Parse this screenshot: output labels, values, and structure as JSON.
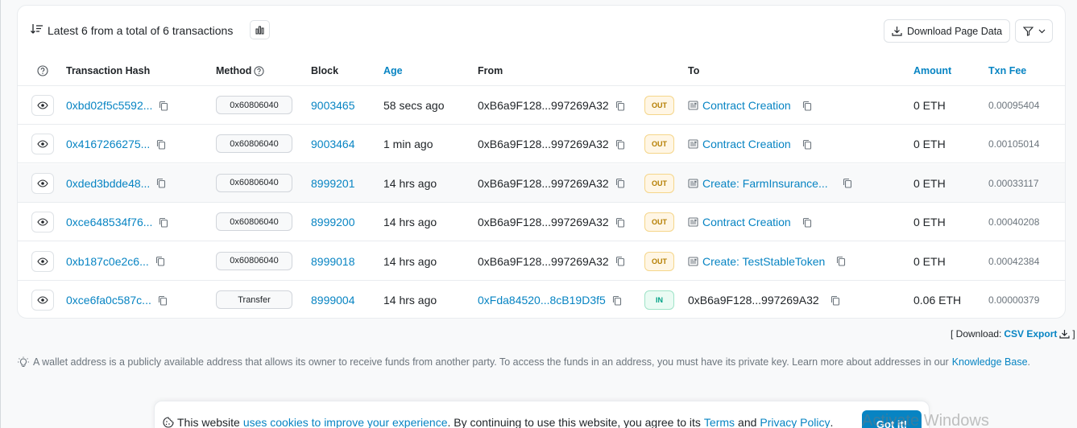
{
  "summary": {
    "text": "Latest 6 from a total of 6 transactions"
  },
  "actions": {
    "download_label": "Download Page Data"
  },
  "columns": {
    "hash": "Transaction Hash",
    "method": "Method",
    "block": "Block",
    "age": "Age",
    "from": "From",
    "to": "To",
    "amount": "Amount",
    "fee": "Txn Fee"
  },
  "rows": [
    {
      "hash": "0xbd02f5c5592...",
      "method": "0x60806040",
      "block": "9003465",
      "age": "58 secs ago",
      "from": "0xB6a9F128...997269A32",
      "direction": "OUT",
      "to": "Contract Creation",
      "amount": "0 ETH",
      "fee": "0.00095404"
    },
    {
      "hash": "0x4167266275...",
      "method": "0x60806040",
      "block": "9003464",
      "age": "1 min ago",
      "from": "0xB6a9F128...997269A32",
      "direction": "OUT",
      "to": "Contract Creation",
      "amount": "0 ETH",
      "fee": "0.00105014"
    },
    {
      "hash": "0xded3bdde48...",
      "method": "0x60806040",
      "block": "8999201",
      "age": "14 hrs ago",
      "from": "0xB6a9F128...997269A32",
      "direction": "OUT",
      "to": "Create: FarmInsurance...",
      "amount": "0 ETH",
      "fee": "0.00033117"
    },
    {
      "hash": "0xce648534f76...",
      "method": "0x60806040",
      "block": "8999200",
      "age": "14 hrs ago",
      "from": "0xB6a9F128...997269A32",
      "direction": "OUT",
      "to": "Contract Creation",
      "amount": "0 ETH",
      "fee": "0.00040208"
    },
    {
      "hash": "0xb187c0e2c6...",
      "method": "0x60806040",
      "block": "8999018",
      "age": "14 hrs ago",
      "from": "0xB6a9F128...997269A32",
      "direction": "OUT",
      "to": "Create: TestStableToken",
      "amount": "0 ETH",
      "fee": "0.00042384"
    },
    {
      "hash": "0xce6fa0c587c...",
      "method": "Transfer",
      "block": "8999004",
      "age": "14 hrs ago",
      "from": "0xFda84520...8cB19D3f5",
      "direction": "IN",
      "to": "0xB6a9F128...997269A32",
      "amount": "0.06 ETH",
      "fee": "0.00000379"
    }
  ],
  "csv": {
    "prefix": "[ Download:",
    "link": "CSV Export",
    "suffix": "]"
  },
  "note": {
    "text": "A wallet address is a publicly available address that allows its owner to receive funds from another party. To access the funds in an address, you must have its private key. Learn more about addresses in our",
    "link": "Knowledge Base",
    "end": "."
  },
  "cookie": {
    "t1": "This website",
    "l1": "uses cookies to improve your experience",
    "t2": ". By continuing to use this website, you agree to its",
    "l2": "Terms",
    "t3": "and",
    "l3": "Privacy Policy",
    "t4": ".",
    "button": "Got it!"
  },
  "watermark": "Activate Windows",
  "colors": {
    "link": "#0784c3",
    "out_badge": "#b47d00",
    "in_badge": "#00a186"
  }
}
